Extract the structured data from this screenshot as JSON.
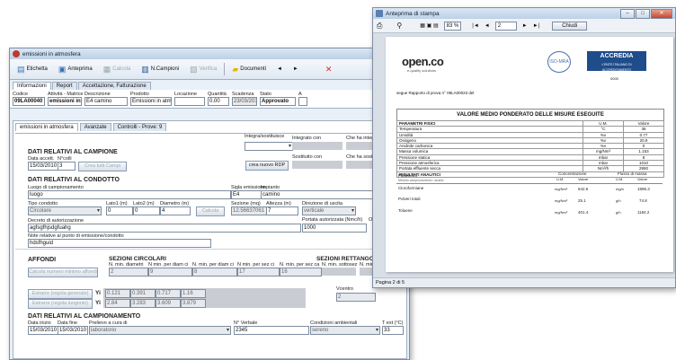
{
  "main": {
    "title": "emissioni in atmosfera",
    "toolbar": [
      "Etichetta",
      "Anteprima",
      "Calcola",
      "N.Campioni",
      "Verifica",
      "Documenti",
      "◄",
      "►",
      "✕"
    ],
    "tabs": [
      "Informazioni",
      "Report",
      "Accettazione, Fatturazione"
    ],
    "header": {
      "labels": [
        "Codice",
        "Attività - Matrice",
        "Descrizione",
        "Prodotto",
        "Locazione",
        "Quantità",
        "Scadenza",
        "Stato",
        "A"
      ],
      "values": [
        "09LA00040",
        "emissioni in atmosfe",
        "E4 camino",
        "Emissioni in atmosfera",
        "",
        "0.00",
        "23/03/2010",
        "Approvato",
        ""
      ]
    },
    "subtabs": [
      "emissioni in atmosfera",
      "Avanzate",
      "Controlli - Prove: 9"
    ],
    "campione": {
      "title": "DATI RELATIVI AL CAMPIONE",
      "date_label": "Data accett.",
      "date": "15/03/2010",
      "ncol_label": "N°colli",
      "ncol": "3",
      "crea": "Crea tutti Campi",
      "integra_label": "Integra/sostituisce",
      "integrato_label": "Integrato con",
      "chehaint_label": "Che ha integr",
      "sostituito_label": "Sostituito con",
      "chehasost_label": "Che ha sosti",
      "nuovo": "crea nuovo RDP"
    },
    "condotto": {
      "title": "DATI RELATIVI AL CONDOTTO",
      "luogo_label": "Luogo di campionamento",
      "luogo": "luogo",
      "sigla_label": "Sigla emissione",
      "sigla": "E4",
      "impianto_label": "Impianto",
      "impianto": "camino",
      "tipo_label": "Tipo condotto",
      "tipo": "Circolare",
      "lato1_label": "Lato1 (m)",
      "lato1": "0",
      "lato2_label": "Lato2 (m)",
      "lato2": "0",
      "diam_label": "Diametro (m)",
      "diam": "4",
      "calcola": "Calcola",
      "sezione_label": "Sezione (mq)",
      "sezione": "12.56637061",
      "altezza_label": "Altezza (m)",
      "altezza": "7",
      "direzione_label": "Direzione di uscita",
      "direzione": "verticale",
      "decreto_label": "Decreto di autorizzazione",
      "decreto": "agfsgfhjsdgfuahg",
      "portata_label": "Portata autorizzata (Nmc/h)",
      "portata": "1000",
      "o_label": "O",
      "note_label": "Note relative al punto di emissione/condotto",
      "note": "hdsfhguid"
    },
    "affondi": {
      "title": "AFFONDI",
      "calc": "Calcola numero minimo affondi",
      "sez_circ": "SEZIONI CIRCOLARI",
      "sez_rett": "SEZIONI RETTANGOLARI",
      "cols": [
        "N. min. diametri",
        "N min. per diam ci",
        "N. min. per diam ci",
        "N min. per sez ci",
        "N. min. per sez ca",
        "N. min. sottosez",
        "N. min. misurazi"
      ],
      "row": [
        "2",
        "9",
        "8",
        "17",
        "16"
      ],
      "estrarre1": "Estrarre (regola generale)",
      "estrarre2": "Estrarre (regola lungimin)",
      "yi": "Yi",
      "yi1": [
        "0.121",
        "0.391",
        "0.717",
        "1.16"
      ],
      "yi2": [
        "2.84",
        "3.283",
        "3.609",
        "3.879"
      ],
      "vcentro_label": "Vcentro",
      "vcentro": "2"
    },
    "camp": {
      "title": "DATI RELATIVI AL CAMPIONAMENTO",
      "labels": [
        "Data inizio",
        "Data fine",
        "Prelievo a cura di",
        "N° Verbale",
        "Condizioni ambientali",
        "T ext (°C)"
      ],
      "values": [
        "15/03/2010",
        "15/03/2010",
        "laboratorio",
        "2345",
        "sereno",
        "33"
      ]
    }
  },
  "preview": {
    "title": "Anteprima di stampa",
    "zoom": "83 %",
    "page": "2",
    "chiudi": "Chiudi",
    "status": "Pagina 2 di 5",
    "logo": "open.co",
    "logo_sub": "e-quality solutions",
    "accredia": "ACCREDIA",
    "accredia_sub": "L'ENTE ITALIANO DI ACCREDITAMENTO",
    "iso": "ISO-MRA",
    "lab_no": "0000",
    "segue": "segue Rapporto di prova n° 09LA00023 del",
    "doc_title": "VALORE MEDIO PONDERATO DELLE MISURE ESEGUITE",
    "fisici_head": [
      "PARAMETRI FISICI",
      "U.M.",
      "Valore"
    ],
    "fisici": [
      [
        "Temperatura",
        "°C",
        "36"
      ],
      [
        "Umidità",
        "%v",
        "0.77"
      ],
      [
        "Ossigeno",
        "%v",
        "20.9"
      ],
      [
        "Anidride carbonica",
        "%v",
        "0"
      ],
      [
        "Massa volumica",
        "mg/Nm³",
        "1.153"
      ],
      [
        "Pressione statica",
        "mbar",
        "8"
      ],
      [
        "Pressione atmosferica",
        "mbar",
        "1010"
      ],
      [
        "Portata effluente secca",
        "Nm³/h",
        "2950"
      ]
    ],
    "analitici": "RISULTATI ANALITICI",
    "an_head": [
      "Parametro",
      "Concentrazione",
      "Flusso di massa"
    ],
    "an_sub": [
      "Metodo campionamento / analisi",
      "U.M.",
      "Valore",
      "U.M.",
      "Valore"
    ],
    "an": [
      [
        "Cloroformiane",
        "mg/Nm³",
        "642.6",
        "mg/h",
        "1896.3"
      ],
      [
        "Polveri totali",
        "mg/Nm³",
        "25.1",
        "g/h",
        "74.8"
      ],
      [
        "Toluene",
        "mg/Nm³",
        "401.4",
        "g/h",
        "1184.2"
      ]
    ]
  }
}
